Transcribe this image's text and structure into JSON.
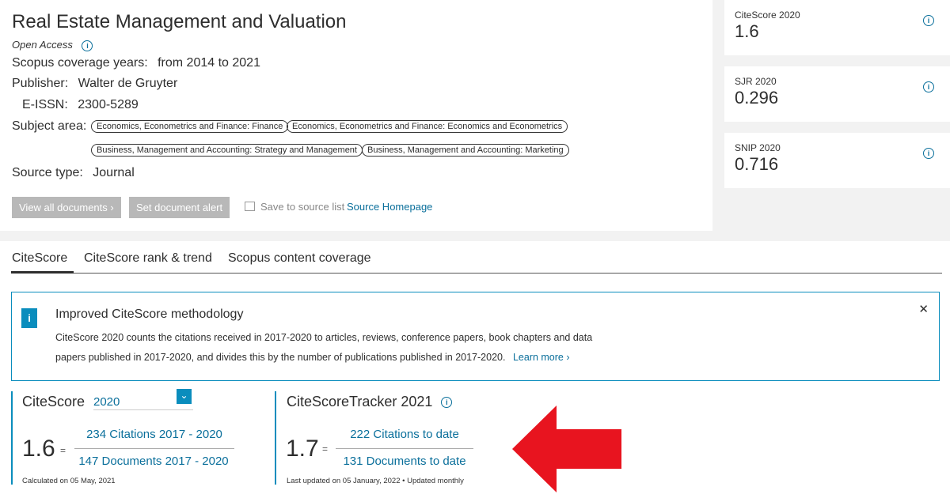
{
  "source": {
    "title": "Real Estate Management and Valuation",
    "open_access": "Open Access",
    "coverage_label": "Scopus coverage years:",
    "coverage_value": "from 2014 to 2021",
    "publisher_label": "Publisher:",
    "publisher_value": "Walter de Gruyter",
    "eissn_label": "E-ISSN:",
    "eissn_value": "2300-5289",
    "subject_label": "Subject area:",
    "subjects": [
      "Economics, Econometrics and Finance: Finance",
      "Economics, Econometrics and Finance: Economics and Econometrics",
      "Business, Management and Accounting: Strategy and Management",
      "Business, Management and Accounting: Marketing"
    ],
    "source_type_label": "Source type:",
    "source_type_value": "Journal",
    "buttons": {
      "view_all": "View all documents",
      "set_alert": "Set document alert",
      "save_list": "Save to source list",
      "homepage": "Source Homepage"
    }
  },
  "metrics": [
    {
      "label": "CiteScore 2020",
      "value": "1.6"
    },
    {
      "label": "SJR 2020",
      "value": "0.296"
    },
    {
      "label": "SNIP 2020",
      "value": "0.716"
    }
  ],
  "tabs": [
    "CiteScore",
    "CiteScore rank & trend",
    "Scopus content coverage"
  ],
  "notice": {
    "title": "Improved CiteScore methodology",
    "text": "CiteScore 2020 counts the citations received in 2017-2020 to articles, reviews, conference papers, book chapters and data papers published in 2017-2020, and divides this by the number of publications published in 2017-2020.",
    "learn_more": "Learn more"
  },
  "citescore": {
    "title": "CiteScore",
    "year": "2020",
    "value": "1.6",
    "citations": "234 Citations 2017 - 2020",
    "documents": "147 Documents 2017 - 2020",
    "calculated": "Calculated on 05 May, 2021"
  },
  "tracker": {
    "title": "CiteScoreTracker 2021",
    "value": "1.7",
    "citations": "222 Citations to date",
    "documents": "131 Documents to date",
    "updated": "Last updated on 05 January, 2022 • Updated monthly"
  },
  "colors": {
    "accent": "#0a8dbd",
    "link": "#0a6f9b",
    "arrow": "#e8141f"
  }
}
